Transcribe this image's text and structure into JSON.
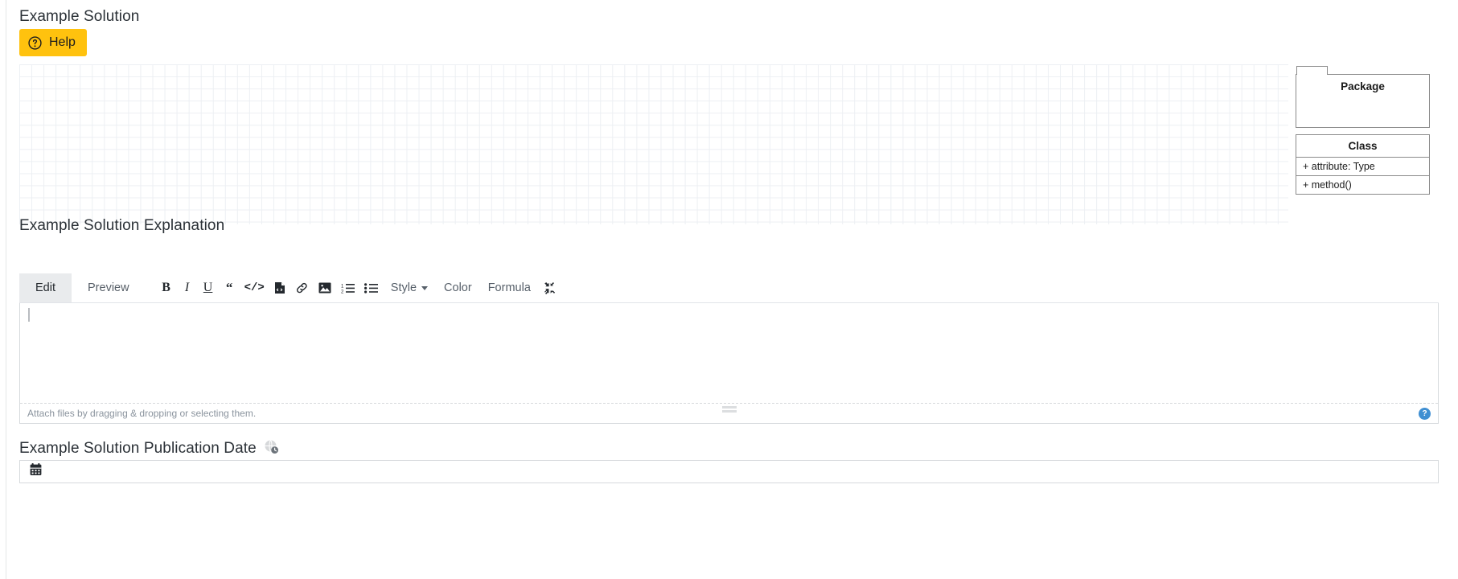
{
  "solution_section": {
    "label": "Example Solution",
    "help_button": {
      "label": "Help",
      "icon": "question-circle-icon",
      "color": "#ffc20e"
    },
    "canvas": {
      "grid": "on",
      "grid_color": "#eceff3",
      "elements": []
    },
    "palette": {
      "shapes": [
        {
          "type": "uml-package",
          "title": "Package"
        },
        {
          "type": "uml-class",
          "title": "Class",
          "attributes": [
            "+ attribute: Type"
          ],
          "methods": [
            "+ method()"
          ]
        }
      ]
    }
  },
  "explanation_section": {
    "label": "Example Solution Explanation",
    "tabs": [
      {
        "label": "Edit",
        "active": true
      },
      {
        "label": "Preview",
        "active": false
      }
    ],
    "toolbar": [
      {
        "name": "bold-button",
        "label": "B",
        "icon": "bold-icon",
        "kind": "text"
      },
      {
        "name": "italic-button",
        "label": "I",
        "icon": "italic-icon",
        "kind": "text"
      },
      {
        "name": "underline-button",
        "label": "U",
        "icon": "underline-icon",
        "kind": "text"
      },
      {
        "name": "quote-button",
        "label": "“",
        "icon": "quote-icon",
        "kind": "text"
      },
      {
        "name": "inline-code-button",
        "label": "</>",
        "icon": "code-icon",
        "kind": "text"
      },
      {
        "name": "code-block-button",
        "label": "",
        "icon": "file-code-icon",
        "kind": "svg"
      },
      {
        "name": "link-button",
        "label": "",
        "icon": "link-icon",
        "kind": "svg"
      },
      {
        "name": "image-button",
        "label": "",
        "icon": "image-icon",
        "kind": "svg"
      },
      {
        "name": "ordered-list-button",
        "label": "",
        "icon": "ordered-list-icon",
        "kind": "svg"
      },
      {
        "name": "unordered-list-button",
        "label": "",
        "icon": "unordered-list-icon",
        "kind": "svg"
      },
      {
        "name": "style-dropdown",
        "label": "Style",
        "icon": "chevron-down-icon",
        "kind": "dropdown"
      },
      {
        "name": "color-button",
        "label": "Color",
        "icon": "color-icon",
        "kind": "text-label"
      },
      {
        "name": "formula-button",
        "label": "Formula",
        "icon": "formula-icon",
        "kind": "text-label"
      },
      {
        "name": "fullscreen-button",
        "label": "",
        "icon": "compress-arrows-icon",
        "kind": "svg"
      }
    ],
    "textarea": {
      "value": "",
      "placeholder": ""
    },
    "attach": {
      "text": "Attach files by dragging & dropping or selecting them.",
      "help_icon": "question-circle-icon",
      "help_icon_color": "#3f8fd2"
    }
  },
  "publication_date_section": {
    "label": "Example Solution Publication Date",
    "timezone_icon": "globe-clock-icon",
    "input": {
      "icon": "calendar-icon",
      "value": "",
      "placeholder": ""
    }
  }
}
